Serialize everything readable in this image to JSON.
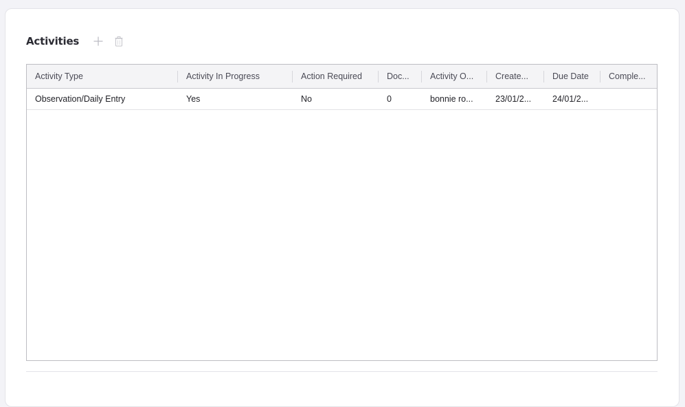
{
  "panel": {
    "title": "Activities",
    "add_icon": "plus-icon",
    "delete_icon": "trash-icon"
  },
  "table": {
    "columns": [
      "Activity Type",
      "Activity In Progress",
      "Action Required",
      "Doc...",
      "Activity O...",
      "Create...",
      "Due Date",
      "Comple..."
    ],
    "rows": [
      [
        "Observation/Daily Entry",
        "Yes",
        "No",
        "0",
        "bonnie ro...",
        "23/01/2...",
        "24/01/2...",
        ""
      ]
    ]
  },
  "colors": {
    "page_bg": "#f3f3f7",
    "panel_bg": "#ffffff",
    "header_bg": "#f4f4f6",
    "icon_muted": "#b9b9c0"
  }
}
